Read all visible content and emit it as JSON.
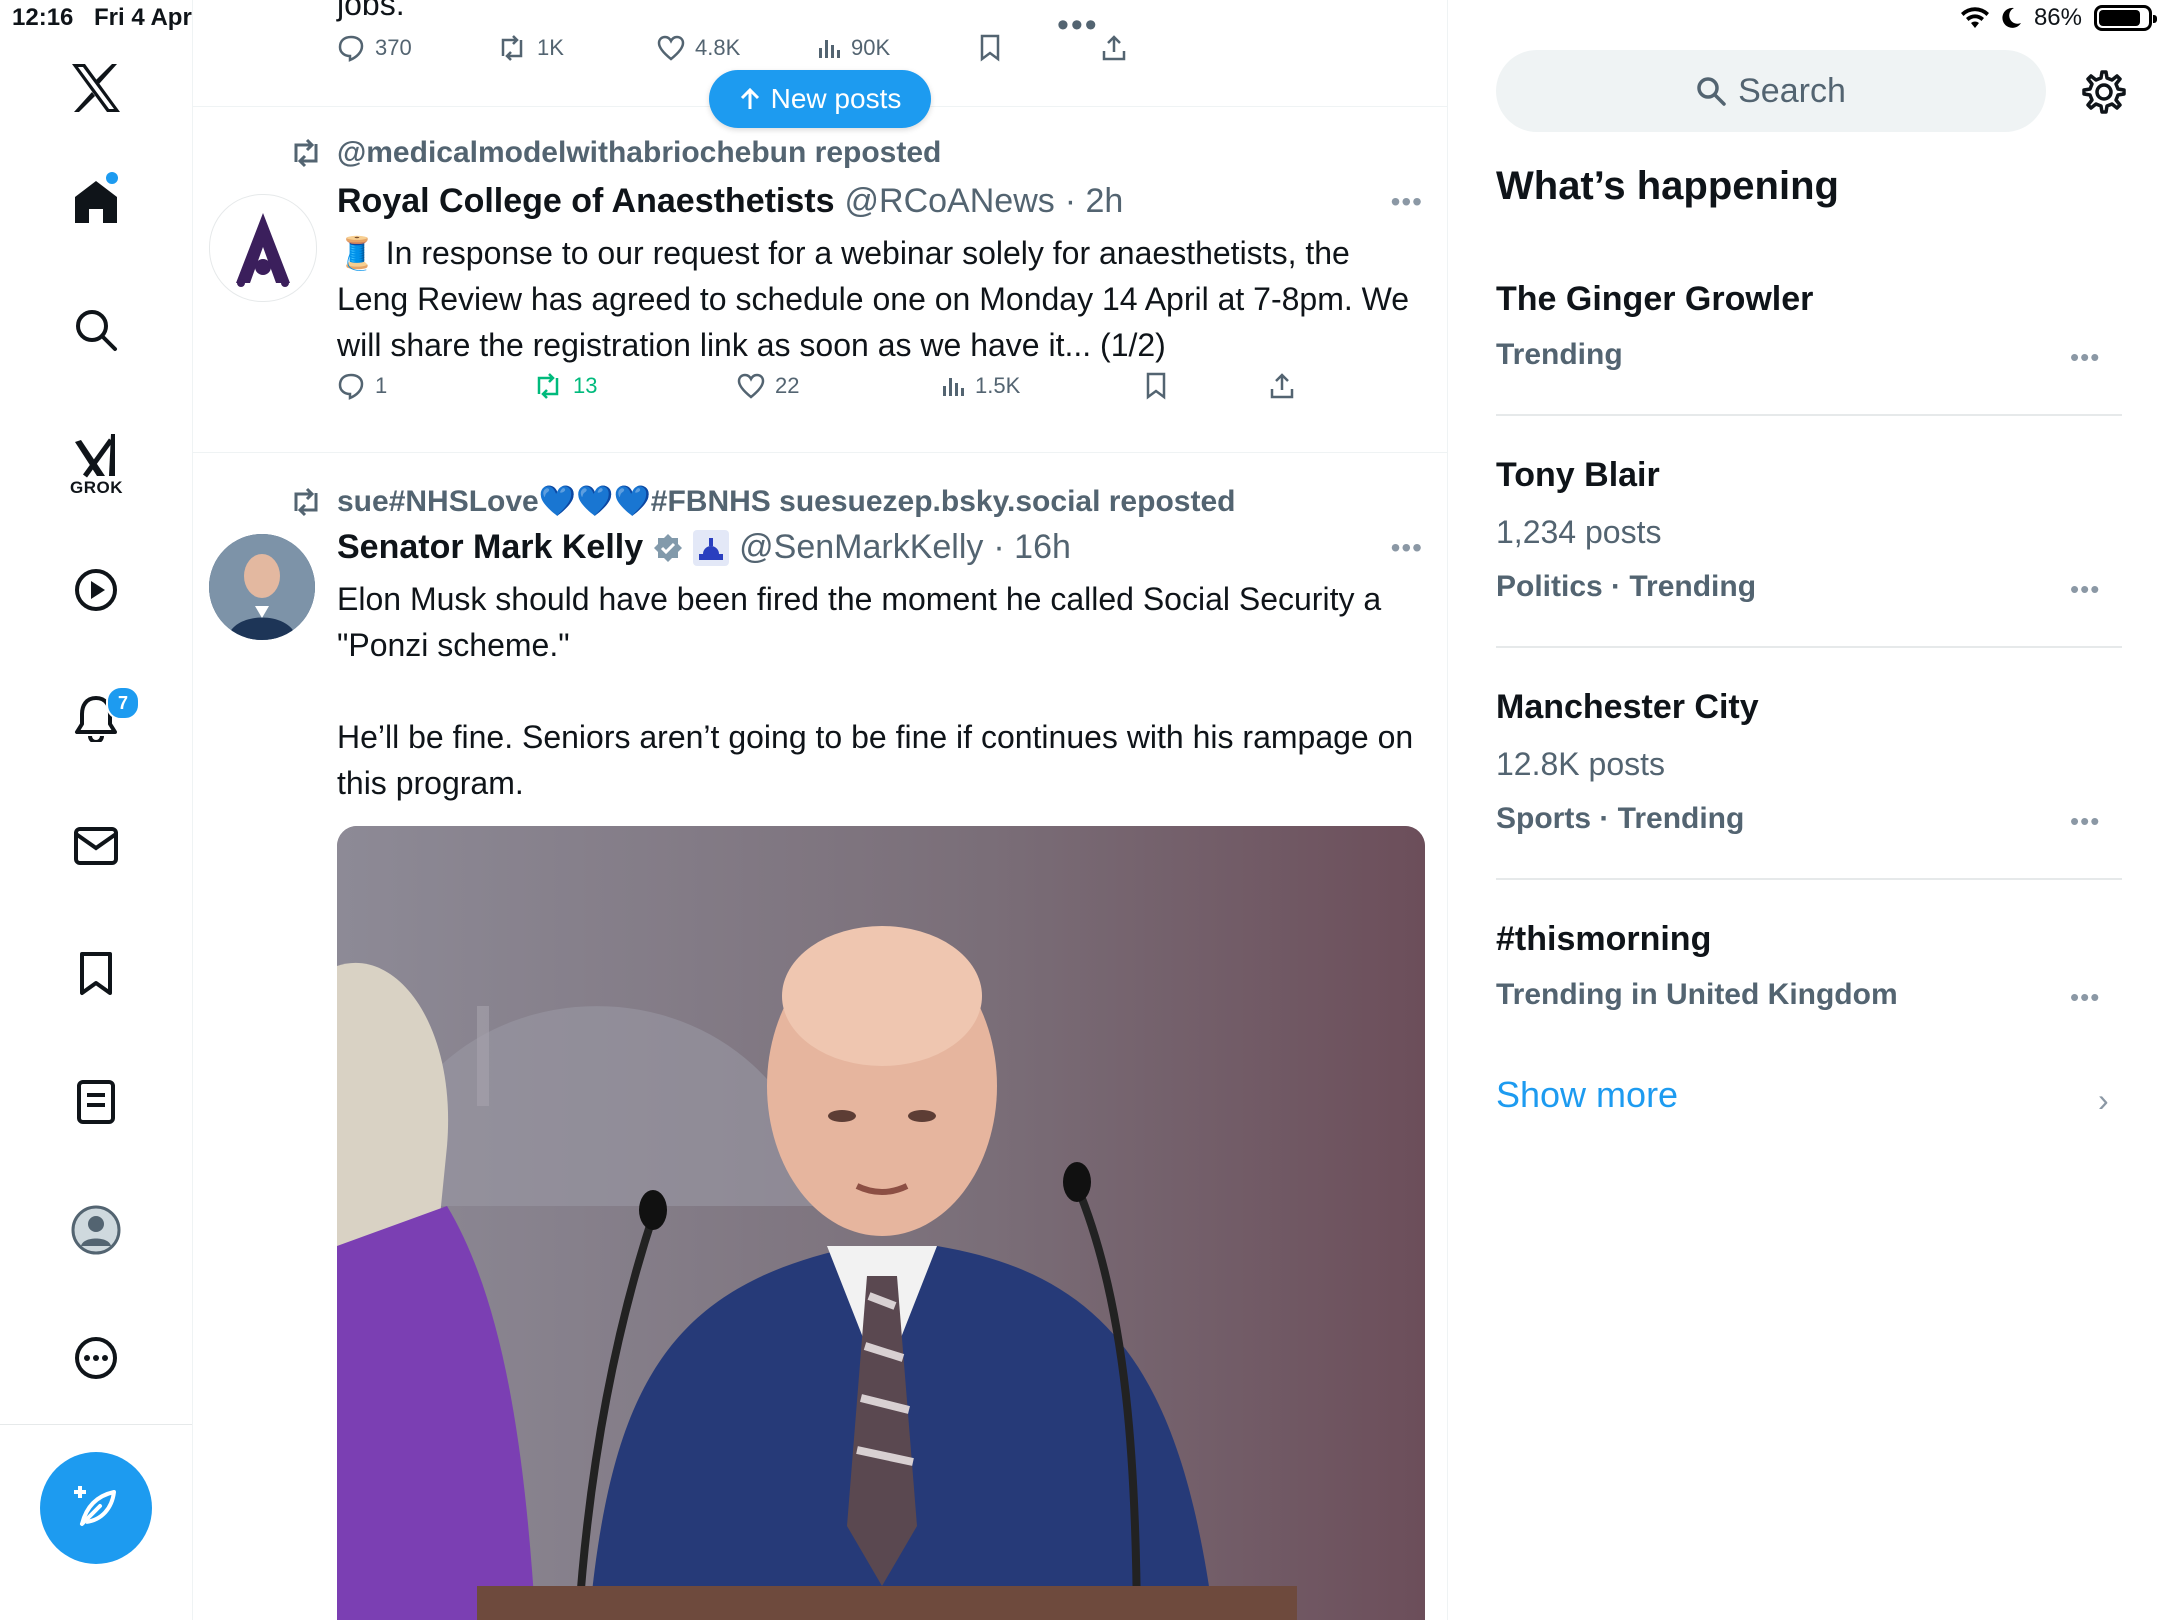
{
  "status": {
    "time": "12:16",
    "date": "Fri 4 Apr",
    "battery": "86%",
    "battery_level": 0.86
  },
  "nav": {
    "grok_label": "GROK",
    "notifications_badge": "7",
    "items": [
      "x-logo",
      "home",
      "explore",
      "grok",
      "video",
      "notifications",
      "messages",
      "bookmarks",
      "lists",
      "profile",
      "more"
    ]
  },
  "feed": {
    "new_posts_label": "New posts",
    "prev_post": {
      "text_tail": "jobs.",
      "replies": "370",
      "reposts": "1K",
      "likes": "4.8K",
      "views": "90K"
    },
    "posts": [
      {
        "reposted_by": "@medicalmodelwithabriochebun reposted",
        "name": "Royal College of Anaesthetists",
        "handle": "@RCoANews",
        "time": "· 2h",
        "text": "🧵 In response to our request for a webinar solely for anaesthetists, the Leng Review has agreed to schedule one on Monday 14 April at 7-8pm. We will share the registration link as soon as we have it... (1/2)",
        "replies": "1",
        "reposts": "13",
        "likes": "22",
        "views": "1.5K"
      },
      {
        "reposted_by": "sue#NHSLove💙💙💙#FBNHS suesuezep.bsky.social reposted",
        "name": "Senator Mark Kelly",
        "handle": "@SenMarkKelly",
        "time": "· 16h",
        "text_p1": "Elon Musk should have been fired the moment he called Social Security a \"Ponzi scheme.\"",
        "text_p2": "He’ll be fine. Seniors aren’t going to be fine if continues with his rampage on this program."
      }
    ]
  },
  "sidebar": {
    "search_placeholder": "Search",
    "heading": "What’s happening",
    "trends": [
      {
        "title": "The Ginger Growler",
        "meta": "Trending"
      },
      {
        "title": "Tony Blair",
        "posts": "1,234 posts",
        "meta": "Politics · Trending"
      },
      {
        "title": "Manchester City",
        "posts": "12.8K posts",
        "meta": "Sports · Trending"
      },
      {
        "title": "#thismorning",
        "meta": "Trending in United Kingdom"
      }
    ],
    "show_more": "Show more"
  },
  "colors": {
    "accent": "#1d9bf0",
    "repost_green": "#00ba7c",
    "muted": "#536471"
  }
}
